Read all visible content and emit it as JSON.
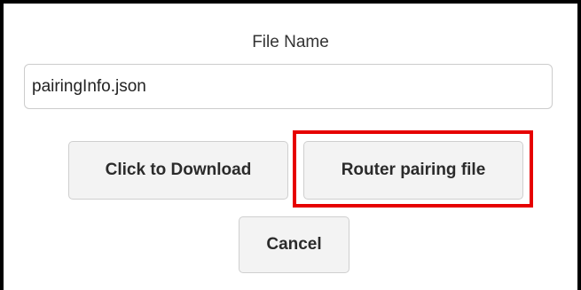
{
  "dialog": {
    "file_name_label": "File Name",
    "file_name_value": "pairingInfo.json",
    "buttons": {
      "download_label": "Click to Download",
      "router_pairing_label": "Router pairing file",
      "cancel_label": "Cancel"
    },
    "highlight_color": "#e60000"
  }
}
